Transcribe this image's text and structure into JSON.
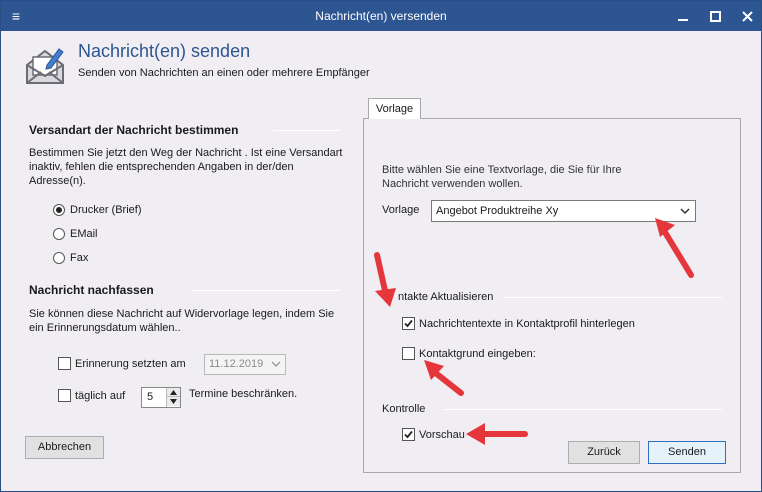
{
  "window": {
    "title": "Nachricht(en) versenden",
    "system_icon": "≡"
  },
  "header": {
    "title": "Nachricht(en) senden",
    "subtitle": "Senden von Nachrichten an einen oder mehrere Empfänger"
  },
  "versandart": {
    "title": "Versandart der Nachricht bestimmen",
    "description_lines": [
      "Bestimmen Sie jetzt den Weg der Nachricht . Ist eine Versandart",
      "inaktiv, fehlen die entsprechenden Angaben in der/den",
      "Adresse(n)."
    ],
    "options": [
      {
        "label": "Drucker (Brief)",
        "selected": true
      },
      {
        "label": "EMail",
        "selected": false
      },
      {
        "label": "Fax",
        "selected": false
      }
    ]
  },
  "nachfassen": {
    "title": "Nachricht nachfassen",
    "description_lines": [
      "Sie können diese Nachricht auf Widervorlage legen, indem Sie",
      "ein Erinnerungsdatum wählen.."
    ],
    "reminder_label": "Erinnerung setzten am",
    "reminder_checked": false,
    "reminder_date": "11.12.2019",
    "daily_label": "täglich auf",
    "daily_checked": false,
    "daily_value": "5",
    "daily_suffix": "Termine beschränken."
  },
  "buttons": {
    "cancel": "Abbrechen",
    "back": "Zurück",
    "send": "Senden"
  },
  "vorlage_tab": {
    "tab_label": "Vorlage",
    "description_lines": [
      "Bitte wählen Sie eine Textvorlage, die Sie für Ihre",
      "Nachricht verwenden wollen."
    ],
    "template_label": "Vorlage",
    "template_value": "Angebot Produktreihe Xy",
    "kontakte_title": "ntakte Aktualisieren",
    "save_texts_label": "Nachrichtentexte in Kontaktprofil hinterlegen",
    "save_texts_checked": true,
    "reason_label": "Kontaktgrund eingeben:",
    "reason_checked": false,
    "kontrolle_title": "Kontrolle",
    "preview_label": "Vorschau",
    "preview_checked": true
  },
  "colors": {
    "titlebar": "#2d5591",
    "accent_title": "#2d5591",
    "annotation_arrow": "#e5363b"
  }
}
